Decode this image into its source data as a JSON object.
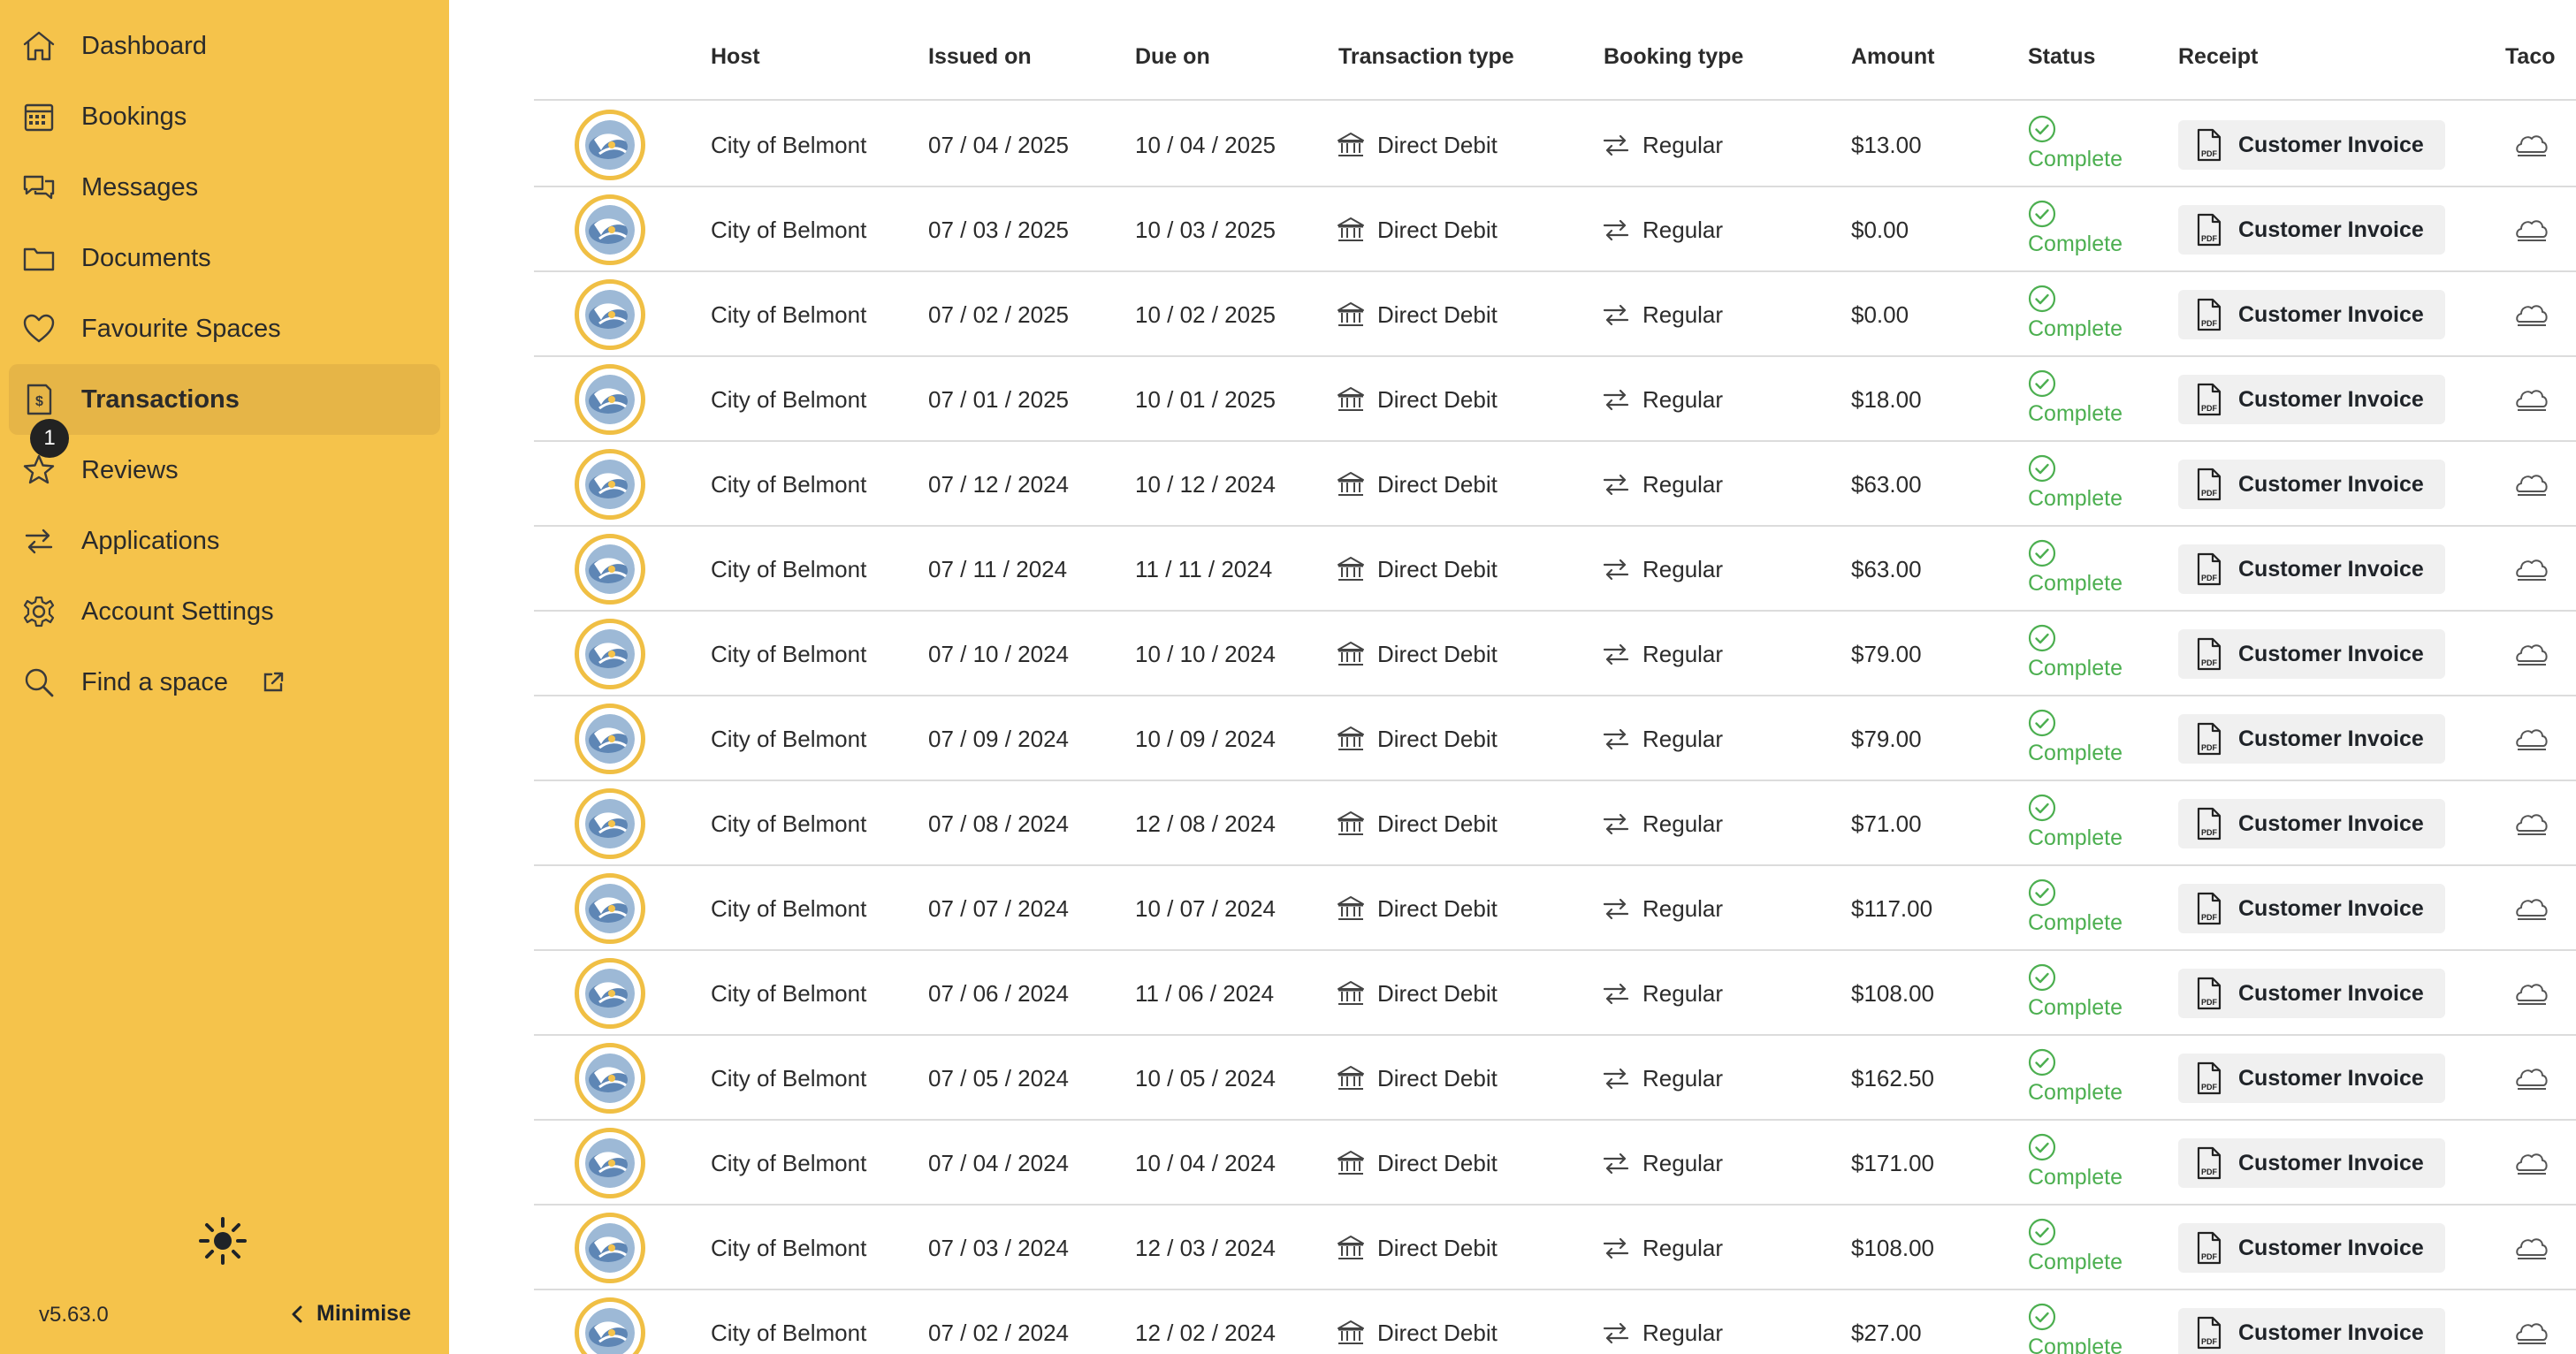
{
  "sidebar": {
    "items": [
      {
        "label": "Dashboard",
        "icon": "home-icon"
      },
      {
        "label": "Bookings",
        "icon": "calendar-icon"
      },
      {
        "label": "Messages",
        "icon": "chat-icon"
      },
      {
        "label": "Documents",
        "icon": "folder-icon"
      },
      {
        "label": "Favourite Spaces",
        "icon": "heart-icon"
      },
      {
        "label": "Transactions",
        "icon": "receipt-dollar-icon",
        "active": true
      },
      {
        "label": "Reviews",
        "icon": "star-icon",
        "badge": "1"
      },
      {
        "label": "Applications",
        "icon": "swap-arrows-icon"
      },
      {
        "label": "Account Settings",
        "icon": "gear-icon"
      },
      {
        "label": "Find a space",
        "icon": "search-icon",
        "external": true
      }
    ],
    "version": "v5.63.0",
    "minimise_label": "Minimise",
    "accent_color": "#F5C34B"
  },
  "table": {
    "headers": {
      "host": "Host",
      "issued_on": "Issued on",
      "due_on": "Due on",
      "transaction_type": "Transaction type",
      "booking_type": "Booking type",
      "amount": "Amount",
      "status": "Status",
      "receipt": "Receipt",
      "taco": "Taco"
    },
    "rows": [
      {
        "host": "City of Belmont",
        "issued": "07 / 04 / 2025",
        "due": "10 / 04 / 2025",
        "txn_type": "Direct Debit",
        "booking_type": "Regular",
        "amount": "$13.00",
        "status": "Complete",
        "receipt": "Customer Invoice"
      },
      {
        "host": "City of Belmont",
        "issued": "07 / 03 / 2025",
        "due": "10 / 03 / 2025",
        "txn_type": "Direct Debit",
        "booking_type": "Regular",
        "amount": "$0.00",
        "status": "Complete",
        "receipt": "Customer Invoice"
      },
      {
        "host": "City of Belmont",
        "issued": "07 / 02 / 2025",
        "due": "10 / 02 / 2025",
        "txn_type": "Direct Debit",
        "booking_type": "Regular",
        "amount": "$0.00",
        "status": "Complete",
        "receipt": "Customer Invoice"
      },
      {
        "host": "City of Belmont",
        "issued": "07 / 01 / 2025",
        "due": "10 / 01 / 2025",
        "txn_type": "Direct Debit",
        "booking_type": "Regular",
        "amount": "$18.00",
        "status": "Complete",
        "receipt": "Customer Invoice"
      },
      {
        "host": "City of Belmont",
        "issued": "07 / 12 / 2024",
        "due": "10 / 12 / 2024",
        "txn_type": "Direct Debit",
        "booking_type": "Regular",
        "amount": "$63.00",
        "status": "Complete",
        "receipt": "Customer Invoice"
      },
      {
        "host": "City of Belmont",
        "issued": "07 / 11 / 2024",
        "due": "11 / 11 / 2024",
        "txn_type": "Direct Debit",
        "booking_type": "Regular",
        "amount": "$63.00",
        "status": "Complete",
        "receipt": "Customer Invoice"
      },
      {
        "host": "City of Belmont",
        "issued": "07 / 10 / 2024",
        "due": "10 / 10 / 2024",
        "txn_type": "Direct Debit",
        "booking_type": "Regular",
        "amount": "$79.00",
        "status": "Complete",
        "receipt": "Customer Invoice"
      },
      {
        "host": "City of Belmont",
        "issued": "07 / 09 / 2024",
        "due": "10 / 09 / 2024",
        "txn_type": "Direct Debit",
        "booking_type": "Regular",
        "amount": "$79.00",
        "status": "Complete",
        "receipt": "Customer Invoice"
      },
      {
        "host": "City of Belmont",
        "issued": "07 / 08 / 2024",
        "due": "12 / 08 / 2024",
        "txn_type": "Direct Debit",
        "booking_type": "Regular",
        "amount": "$71.00",
        "status": "Complete",
        "receipt": "Customer Invoice"
      },
      {
        "host": "City of Belmont",
        "issued": "07 / 07 / 2024",
        "due": "10 / 07 / 2024",
        "txn_type": "Direct Debit",
        "booking_type": "Regular",
        "amount": "$117.00",
        "status": "Complete",
        "receipt": "Customer Invoice"
      },
      {
        "host": "City of Belmont",
        "issued": "07 / 06 / 2024",
        "due": "11 / 06 / 2024",
        "txn_type": "Direct Debit",
        "booking_type": "Regular",
        "amount": "$108.00",
        "status": "Complete",
        "receipt": "Customer Invoice"
      },
      {
        "host": "City of Belmont",
        "issued": "07 / 05 / 2024",
        "due": "10 / 05 / 2024",
        "txn_type": "Direct Debit",
        "booking_type": "Regular",
        "amount": "$162.50",
        "status": "Complete",
        "receipt": "Customer Invoice"
      },
      {
        "host": "City of Belmont",
        "issued": "07 / 04 / 2024",
        "due": "10 / 04 / 2024",
        "txn_type": "Direct Debit",
        "booking_type": "Regular",
        "amount": "$171.00",
        "status": "Complete",
        "receipt": "Customer Invoice"
      },
      {
        "host": "City of Belmont",
        "issued": "07 / 03 / 2024",
        "due": "12 / 03 / 2024",
        "txn_type": "Direct Debit",
        "booking_type": "Regular",
        "amount": "$108.00",
        "status": "Complete",
        "receipt": "Customer Invoice"
      },
      {
        "host": "City of Belmont",
        "issued": "07 / 02 / 2024",
        "due": "12 / 02 / 2024",
        "txn_type": "Direct Debit",
        "booking_type": "Regular",
        "amount": "$27.00",
        "status": "Complete",
        "receipt": "Customer Invoice"
      }
    ]
  },
  "colors": {
    "status_complete": "#4CAF50",
    "avatar_ring": "#F0BF44"
  }
}
